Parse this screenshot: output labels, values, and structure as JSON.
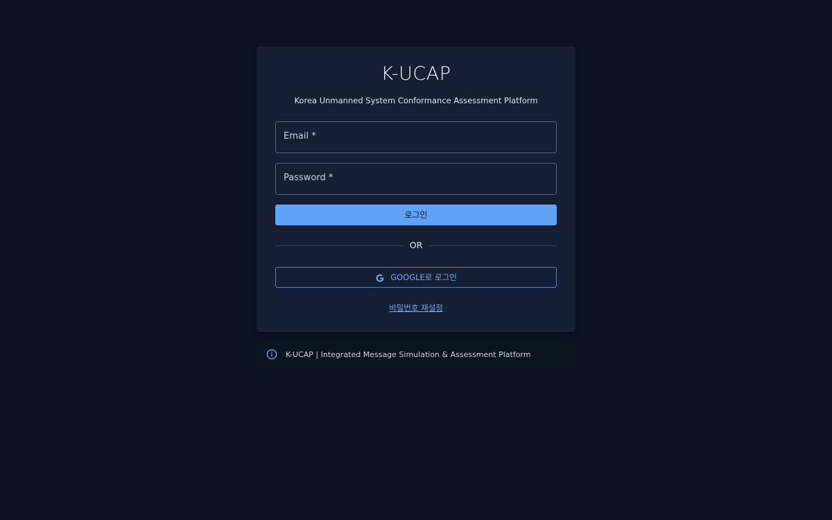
{
  "app": {
    "title": "K-UCAP",
    "subtitle": "Korea Unmanned System Conformance Assessment Platform"
  },
  "form": {
    "email_label": "Email *",
    "password_label": "Password *",
    "login_label": "로그인",
    "divider_text": "OR",
    "google_label": "GOOGLE로 로그인",
    "reset_link": "비밀번호 재설정"
  },
  "info_banner": {
    "text": "K-UCAP | Integrated Message Simulation & Assessment Platform",
    "icon": "info-icon"
  },
  "colors": {
    "background": "#0b1120",
    "card": "#161f33",
    "accent": "#5ea2f5",
    "link": "#6aabf7"
  }
}
